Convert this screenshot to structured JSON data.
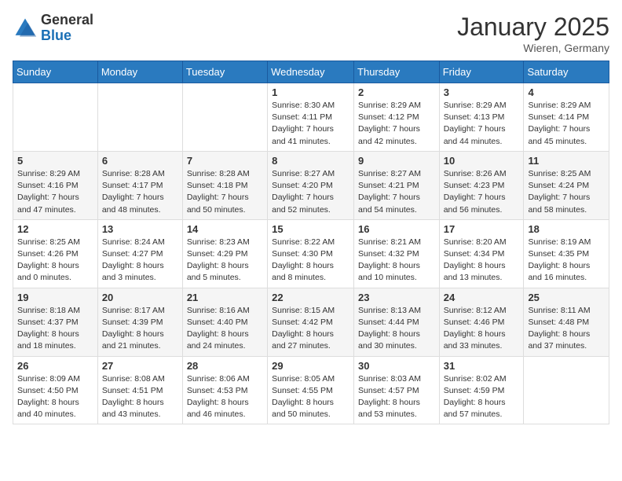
{
  "logo": {
    "general": "General",
    "blue": "Blue"
  },
  "header": {
    "month": "January 2025",
    "location": "Wieren, Germany"
  },
  "days_of_week": [
    "Sunday",
    "Monday",
    "Tuesday",
    "Wednesday",
    "Thursday",
    "Friday",
    "Saturday"
  ],
  "weeks": [
    [
      {
        "day": "",
        "info": ""
      },
      {
        "day": "",
        "info": ""
      },
      {
        "day": "",
        "info": ""
      },
      {
        "day": "1",
        "info": "Sunrise: 8:30 AM\nSunset: 4:11 PM\nDaylight: 7 hours\nand 41 minutes."
      },
      {
        "day": "2",
        "info": "Sunrise: 8:29 AM\nSunset: 4:12 PM\nDaylight: 7 hours\nand 42 minutes."
      },
      {
        "day": "3",
        "info": "Sunrise: 8:29 AM\nSunset: 4:13 PM\nDaylight: 7 hours\nand 44 minutes."
      },
      {
        "day": "4",
        "info": "Sunrise: 8:29 AM\nSunset: 4:14 PM\nDaylight: 7 hours\nand 45 minutes."
      }
    ],
    [
      {
        "day": "5",
        "info": "Sunrise: 8:29 AM\nSunset: 4:16 PM\nDaylight: 7 hours\nand 47 minutes."
      },
      {
        "day": "6",
        "info": "Sunrise: 8:28 AM\nSunset: 4:17 PM\nDaylight: 7 hours\nand 48 minutes."
      },
      {
        "day": "7",
        "info": "Sunrise: 8:28 AM\nSunset: 4:18 PM\nDaylight: 7 hours\nand 50 minutes."
      },
      {
        "day": "8",
        "info": "Sunrise: 8:27 AM\nSunset: 4:20 PM\nDaylight: 7 hours\nand 52 minutes."
      },
      {
        "day": "9",
        "info": "Sunrise: 8:27 AM\nSunset: 4:21 PM\nDaylight: 7 hours\nand 54 minutes."
      },
      {
        "day": "10",
        "info": "Sunrise: 8:26 AM\nSunset: 4:23 PM\nDaylight: 7 hours\nand 56 minutes."
      },
      {
        "day": "11",
        "info": "Sunrise: 8:25 AM\nSunset: 4:24 PM\nDaylight: 7 hours\nand 58 minutes."
      }
    ],
    [
      {
        "day": "12",
        "info": "Sunrise: 8:25 AM\nSunset: 4:26 PM\nDaylight: 8 hours\nand 0 minutes."
      },
      {
        "day": "13",
        "info": "Sunrise: 8:24 AM\nSunset: 4:27 PM\nDaylight: 8 hours\nand 3 minutes."
      },
      {
        "day": "14",
        "info": "Sunrise: 8:23 AM\nSunset: 4:29 PM\nDaylight: 8 hours\nand 5 minutes."
      },
      {
        "day": "15",
        "info": "Sunrise: 8:22 AM\nSunset: 4:30 PM\nDaylight: 8 hours\nand 8 minutes."
      },
      {
        "day": "16",
        "info": "Sunrise: 8:21 AM\nSunset: 4:32 PM\nDaylight: 8 hours\nand 10 minutes."
      },
      {
        "day": "17",
        "info": "Sunrise: 8:20 AM\nSunset: 4:34 PM\nDaylight: 8 hours\nand 13 minutes."
      },
      {
        "day": "18",
        "info": "Sunrise: 8:19 AM\nSunset: 4:35 PM\nDaylight: 8 hours\nand 16 minutes."
      }
    ],
    [
      {
        "day": "19",
        "info": "Sunrise: 8:18 AM\nSunset: 4:37 PM\nDaylight: 8 hours\nand 18 minutes."
      },
      {
        "day": "20",
        "info": "Sunrise: 8:17 AM\nSunset: 4:39 PM\nDaylight: 8 hours\nand 21 minutes."
      },
      {
        "day": "21",
        "info": "Sunrise: 8:16 AM\nSunset: 4:40 PM\nDaylight: 8 hours\nand 24 minutes."
      },
      {
        "day": "22",
        "info": "Sunrise: 8:15 AM\nSunset: 4:42 PM\nDaylight: 8 hours\nand 27 minutes."
      },
      {
        "day": "23",
        "info": "Sunrise: 8:13 AM\nSunset: 4:44 PM\nDaylight: 8 hours\nand 30 minutes."
      },
      {
        "day": "24",
        "info": "Sunrise: 8:12 AM\nSunset: 4:46 PM\nDaylight: 8 hours\nand 33 minutes."
      },
      {
        "day": "25",
        "info": "Sunrise: 8:11 AM\nSunset: 4:48 PM\nDaylight: 8 hours\nand 37 minutes."
      }
    ],
    [
      {
        "day": "26",
        "info": "Sunrise: 8:09 AM\nSunset: 4:50 PM\nDaylight: 8 hours\nand 40 minutes."
      },
      {
        "day": "27",
        "info": "Sunrise: 8:08 AM\nSunset: 4:51 PM\nDaylight: 8 hours\nand 43 minutes."
      },
      {
        "day": "28",
        "info": "Sunrise: 8:06 AM\nSunset: 4:53 PM\nDaylight: 8 hours\nand 46 minutes."
      },
      {
        "day": "29",
        "info": "Sunrise: 8:05 AM\nSunset: 4:55 PM\nDaylight: 8 hours\nand 50 minutes."
      },
      {
        "day": "30",
        "info": "Sunrise: 8:03 AM\nSunset: 4:57 PM\nDaylight: 8 hours\nand 53 minutes."
      },
      {
        "day": "31",
        "info": "Sunrise: 8:02 AM\nSunset: 4:59 PM\nDaylight: 8 hours\nand 57 minutes."
      },
      {
        "day": "",
        "info": ""
      }
    ]
  ]
}
